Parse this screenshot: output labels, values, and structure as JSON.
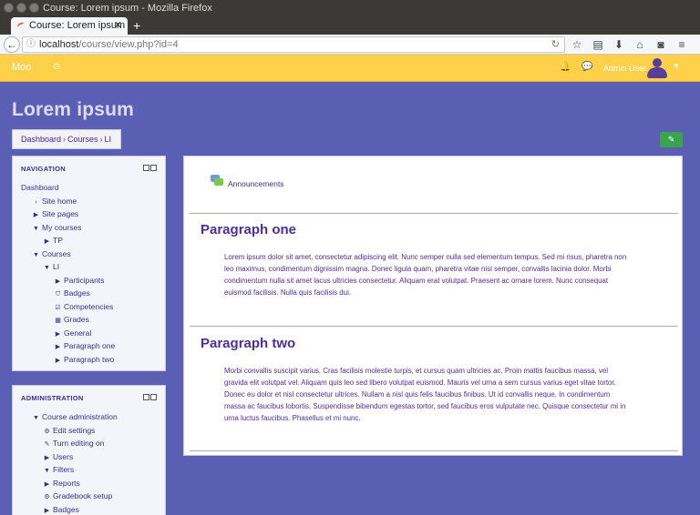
{
  "browser": {
    "window_title": "Course: Lorem ipsum - Mozilla Firefox",
    "tab_title": "Course: Lorem ipsum",
    "url_host": "localhost",
    "url_path": "/course/view.php?id=4"
  },
  "header": {
    "brand": "Moo",
    "username": "Admin User"
  },
  "page": {
    "title": "Lorem ipsum",
    "breadcrumb": [
      "Dashboard",
      "Courses",
      "LI"
    ]
  },
  "navigation": {
    "title": "NAVIGATION",
    "items": [
      {
        "label": "Dashboard",
        "indent": 0,
        "icon": "none"
      },
      {
        "label": "Site home",
        "indent": 1,
        "icon": "chevron-right"
      },
      {
        "label": "Site pages",
        "indent": 1,
        "icon": "triangle-right"
      },
      {
        "label": "My courses",
        "indent": 1,
        "icon": "triangle-down"
      },
      {
        "label": "TP",
        "indent": 2,
        "icon": "triangle-right"
      },
      {
        "label": "Courses",
        "indent": 1,
        "icon": "triangle-down"
      },
      {
        "label": "LI",
        "indent": 2,
        "icon": "triangle-down"
      },
      {
        "label": "Participants",
        "indent": 3,
        "icon": "triangle-right"
      },
      {
        "label": "Badges",
        "indent": 3,
        "icon": "shield"
      },
      {
        "label": "Competencies",
        "indent": 3,
        "icon": "check-square"
      },
      {
        "label": "Grades",
        "indent": 3,
        "icon": "table"
      },
      {
        "label": "General",
        "indent": 3,
        "icon": "triangle-right"
      },
      {
        "label": "Paragraph one",
        "indent": 3,
        "icon": "triangle-right"
      },
      {
        "label": "Paragraph two",
        "indent": 3,
        "icon": "triangle-right"
      }
    ]
  },
  "administration": {
    "title": "ADMINISTRATION",
    "items": [
      {
        "label": "Course administration",
        "indent": 1,
        "icon": "triangle-down"
      },
      {
        "label": "Edit settings",
        "indent": 2,
        "icon": "gear"
      },
      {
        "label": "Turn editing on",
        "indent": 2,
        "icon": "pencil"
      },
      {
        "label": "Users",
        "indent": 2,
        "icon": "triangle-right"
      },
      {
        "label": "Filters",
        "indent": 2,
        "icon": "filter"
      },
      {
        "label": "Reports",
        "indent": 2,
        "icon": "triangle-right"
      },
      {
        "label": "Gradebook setup",
        "indent": 2,
        "icon": "gear"
      },
      {
        "label": "Badges",
        "indent": 2,
        "icon": "triangle-right"
      }
    ]
  },
  "content": {
    "announcements": "Announcements",
    "sections": [
      {
        "title": "Paragraph one",
        "text": "Lorem ipsum dolor sit amet, consectetur adipiscing elit. Nunc semper nulla sed elementum tempus. Sed mi risus, pharetra non leo maximus, condimentum dignissim magna. Donec ligula quam, pharetra vitae nisl semper, convallis lacinia dolor. Morbi condimentum nulla sit amet lacus ultricies consectetur. Aliquam erat volutpat. Praesent ac ornare lorem. Nunc consequat euismod facilisis. Nulla quis facilisis dui."
      },
      {
        "title": "Paragraph two",
        "text": "Morbi convallis suscipit varius. Cras facilisis molestie turpis, et cursus quam ultricies ac. Proin mattis faucibus massa, vel gravida elit volutpat vel. Aliquam quis leo sed libero volutpat euismod. Mauris vel urna a sem cursus varius eget vitae tortor. Donec eu dolor et nisl consectetur ultrices. Nullam a nisl quis felis faucibus finibus. Ut id convallis neque. In condimentum massa ac faucibus lobortis. Suspendisse bibendum egestas tortor, sed faucibus eros vulputate nec. Quisque consectetur mi in urna luctus faucibus. Phasellus et mi nunc."
      }
    ]
  },
  "colors": {
    "header_bg": "#ffd04a",
    "page_bg": "#5b5fb4",
    "link": "#3a2d8e",
    "edit_button": "#3ba34a"
  }
}
